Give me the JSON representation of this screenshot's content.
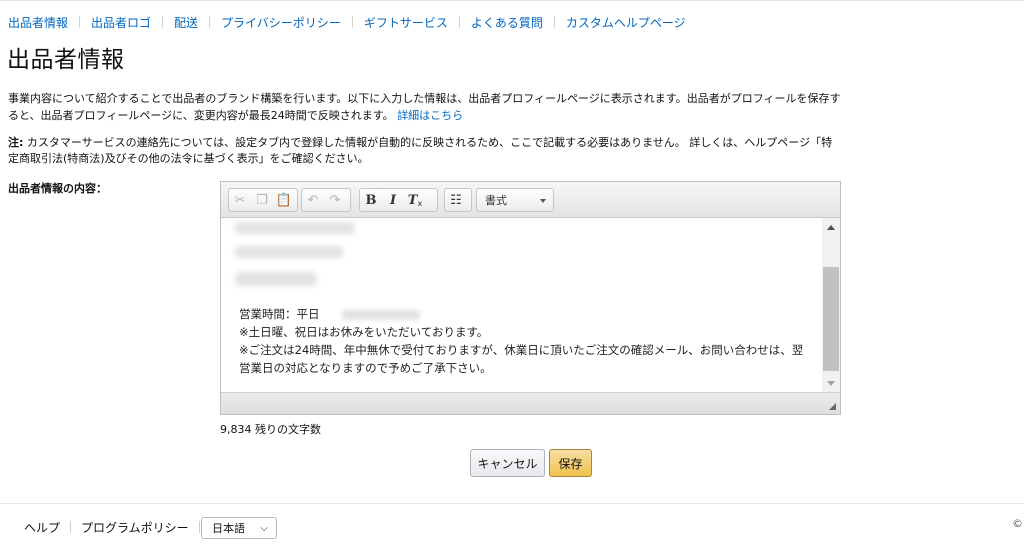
{
  "nav": {
    "items": [
      "出品者情報",
      "出品者ロゴ",
      "配送",
      "プライバシーポリシー",
      "ギフトサービス",
      "よくある質問",
      "カスタムヘルプページ"
    ]
  },
  "page": {
    "title": "出品者情報",
    "intro": "事業内容について紹介することで出品者のブランド構築を行います。以下に入力した情報は、出品者プロフィールページに表示されます。出品者がプロフィールを保存すると、出品者プロフィールページに、変更内容が最長24時間で反映されます。",
    "intro_link": "詳細はこちら",
    "note_label": "注:",
    "note_text": " カスタマーサービスの連絡先については、設定タブ内で登録した情報が自動的に反映されるため、ここで記載する必要はありません。 詳しくは、ヘルプページ「特定商取引法(特商法)及びその他の法令に基づく表示」をご確認ください。",
    "field_label": "出品者情報の内容："
  },
  "editor": {
    "format_label": "書式",
    "line1_label": "営業時間：平日",
    "line2": "※土日曜、祝日はお休みをいただいております。",
    "line3": "※ご注文は24時間、年中無休で受付ておりますが、休業日に頂いたご注文の確認メール、お問い合わせは、翌営業日の対応となりますので予めご了承下さい。",
    "char_count": "9,834 残りの文字数",
    "icons": [
      "cut-icon",
      "copy-icon",
      "paste-icon",
      "undo-icon",
      "redo-icon",
      "bold-icon",
      "italic-icon",
      "remove-format-icon",
      "bulleted-list-icon"
    ]
  },
  "actions": {
    "cancel": "キャンセル",
    "save": "保存"
  },
  "footer": {
    "help": "ヘルプ",
    "program_policy": "プログラムポリシー",
    "language": "日本語",
    "copyright": "©"
  }
}
